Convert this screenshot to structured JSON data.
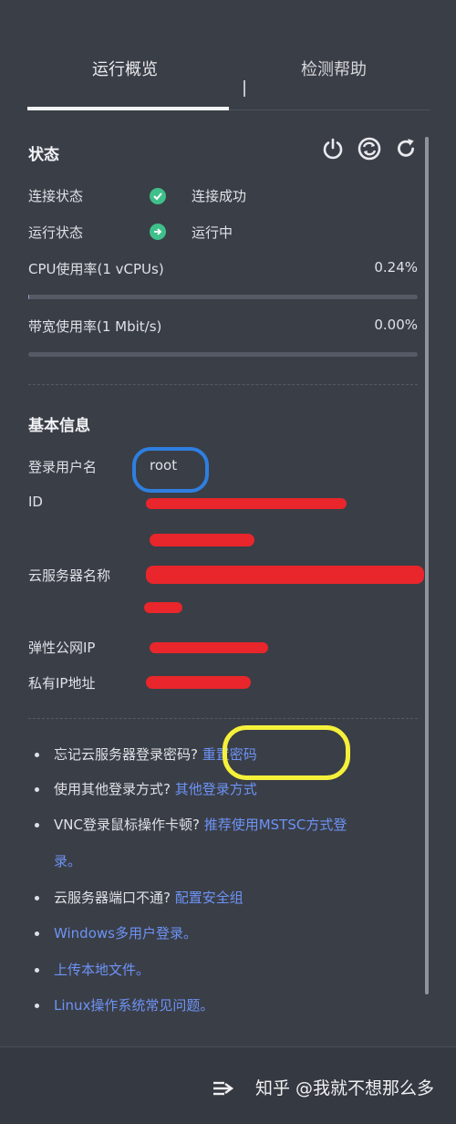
{
  "tabs": [
    "运行概览",
    "检测帮助"
  ],
  "status": {
    "title": "状态",
    "connection": {
      "label": "连接状态",
      "value": "连接成功"
    },
    "running": {
      "label": "运行状态",
      "value": "运行中"
    },
    "cpu": {
      "label": "CPU使用率(1 vCPUs)",
      "value": "0.24%",
      "percent": 0.24
    },
    "bandwidth": {
      "label": "带宽使用率(1 Mbit/s)",
      "value": "0.00%",
      "percent": 0.0
    },
    "controls": [
      "power-icon",
      "restart-icon",
      "refresh-icon"
    ]
  },
  "basic_info": {
    "title": "基本信息",
    "username": {
      "label": "登录用户名",
      "value": "root"
    },
    "id": {
      "label": "ID"
    },
    "server_name": {
      "label": "云服务器名称"
    },
    "public_ip": {
      "label": "弹性公网IP"
    },
    "private_ip": {
      "label": "私有IP地址"
    }
  },
  "help": {
    "items": [
      {
        "text": "忘记云服务器登录密码?",
        "link": "重置密码"
      },
      {
        "text": "使用其他登录方式?",
        "link": "其他登录方式"
      },
      {
        "text": "VNC登录鼠标操作卡顿?",
        "link": "推荐使用MSTSC方式登"
      },
      {
        "text": "",
        "link": "录。"
      },
      {
        "text": "云服务器端口不通?",
        "link": "配置安全组"
      },
      {
        "text": "",
        "link": "Windows多用户登录。"
      },
      {
        "text": "",
        "link": "上传本地文件。"
      },
      {
        "text": "",
        "link": "Linux操作系统常见问题。"
      }
    ]
  },
  "footer": {
    "icon": "collapse-arrow-icon",
    "watermark": "知乎 @我就不想那么多"
  },
  "colors": {
    "background": "#3a3e47",
    "accent": "#6d93f5",
    "success": "#3fbf8a"
  }
}
